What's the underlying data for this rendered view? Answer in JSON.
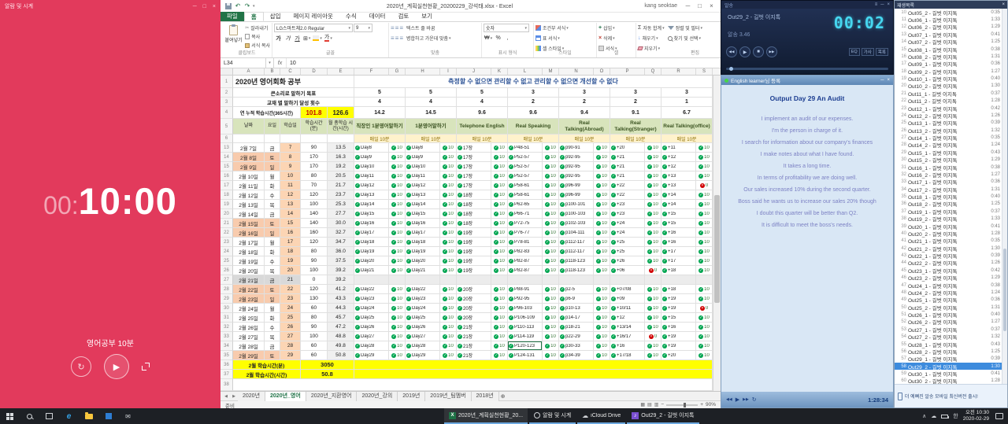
{
  "icons": {
    "check": "✓",
    "cross": "×"
  },
  "timer": {
    "window_title": "알람 및 시계",
    "time_prefix": "00:",
    "time_main": "10:00",
    "label": "영어공부 10분",
    "accent": "#e23a5c"
  },
  "excel": {
    "title": "2020년_계획실천현황_20200229_강석태.xlsx - Excel",
    "user": "kang seoktae",
    "tabs": [
      "파일",
      "홈",
      "삽입",
      "페이지 레이아웃",
      "수식",
      "데이터",
      "검토",
      "보기"
    ],
    "active_tab": "홈",
    "ribbon": {
      "paste": "붙여넣기",
      "cut": "잘라내기",
      "copy": "복사",
      "format_painter": "서식 복사",
      "clipboard_group": "클립보드",
      "font_name": "LG스마트체2.0 Regular",
      "font_size": "9",
      "font_group": "글꼴",
      "wrap_text": "텍스트 줄 바꿈",
      "merge_center": "병합하고 가운데 맞춤",
      "align_group": "맞춤",
      "number_format": "숫자",
      "number_group": "표시 형식",
      "cond_format": "조건부 서식",
      "table_format": "표 서식",
      "cell_styles": "셀 스타일",
      "style_group": "스타일",
      "insert": "삽입",
      "delete": "삭제",
      "format": "서식",
      "cells_group": "셀",
      "autosum": "자동 합계",
      "fill": "채우기",
      "clear": "지우기",
      "sort_filter": "정렬 및 필터",
      "find_select": "찾기 및 선택",
      "edit_group": "편집"
    },
    "name_box": "L34",
    "formula_value": "10",
    "columns": [
      "A",
      "B",
      "C",
      "D",
      "E",
      "F",
      "G",
      "H",
      "I",
      "J",
      "K",
      "L",
      "M",
      "N",
      "O",
      "P",
      "Q",
      "R",
      "S"
    ],
    "sheet": {
      "title": "2020년 영어회화 공부",
      "motto": "측정할 수 없으면 관리할 수 없고 관리할 수 없으면 개선할 수 없다",
      "goal_label": "큰소리로 말하기 목표",
      "goal_values": [
        "5",
        "5",
        "5",
        "3",
        "3",
        "3",
        "3"
      ],
      "achieve_label": "교재 별 말하기 달성 횟수",
      "achieve_values": [
        "4",
        "4",
        "4",
        "2",
        "2",
        "2",
        "1"
      ],
      "annual_label": "연 누적 학습시간(365시간)",
      "annual_min": "101.8",
      "annual_hours": "126.6",
      "category_totals": [
        "14.2",
        "14.5",
        "9.6",
        "9.6",
        "9.4",
        "9.1",
        "6.7"
      ],
      "col_headers": [
        "날짜",
        "요일",
        "학습일",
        "학습시간(분)",
        "월 총학습 시간(시간)"
      ],
      "categories": [
        "직장인 1분영어말하기",
        "1분영어말하기",
        "Telephone English",
        "Real Speaking",
        "Real Talking(Abroad)",
        "Real Talking(Stranger)",
        "Real Talking(office)"
      ],
      "daily_goal": "매일 10분",
      "minute_badge": "10",
      "rows": [
        {
          "n": "13",
          "a": "2월 7일",
          "b": "금",
          "c": "7",
          "d": "90",
          "e": "13.5",
          "cats": [
            "Day8",
            "Day8",
            "17장",
            "P48-51",
            "p90-91",
            "+20",
            "+11"
          ]
        },
        {
          "n": "14",
          "a": "2월 8일",
          "b": "토",
          "c": "8",
          "d": "170",
          "e": "16.3",
          "cats": [
            "Day9",
            "Day9",
            "17장",
            "P52-57",
            "p92-95",
            "+21",
            "+12"
          ],
          "wk": true
        },
        {
          "n": "15",
          "a": "2월 9일",
          "b": "일",
          "c": "9",
          "d": "170",
          "e": "19.2",
          "cats": [
            "Day10",
            "Day10",
            "17장",
            "P52-57",
            "p92-95",
            "+21",
            "+12"
          ],
          "wk": true
        },
        {
          "n": "16",
          "a": "2월 10일",
          "b": "월",
          "c": "10",
          "d": "80",
          "e": "20.5",
          "cats": [
            "Day11",
            "Day11",
            "17장",
            "P52-57",
            "p92-95",
            "+21",
            "+13"
          ]
        },
        {
          "n": "17",
          "a": "2월 11일",
          "b": "화",
          "c": "11",
          "d": "70",
          "e": "21.7",
          "cats": [
            "Day12",
            "Day12",
            "17장",
            "P58-61",
            "p96-99",
            "+22",
            "+13"
          ],
          "red": [
            6
          ]
        },
        {
          "n": "18",
          "a": "2월 12일",
          "b": "수",
          "c": "12",
          "d": "120",
          "e": "23.7",
          "cats": [
            "Day13",
            "Day13",
            "18장",
            "P58-61",
            "p96-99",
            "+22",
            "+14"
          ]
        },
        {
          "n": "19",
          "a": "2월 13일",
          "b": "목",
          "c": "13",
          "d": "100",
          "e": "25.3",
          "cats": [
            "Day14",
            "Day14",
            "18장",
            "P62-65",
            "p100-101",
            "+23",
            "+14"
          ]
        },
        {
          "n": "20",
          "a": "2월 14일",
          "b": "금",
          "c": "14",
          "d": "140",
          "e": "27.7",
          "cats": [
            "Day15",
            "Day15",
            "18장",
            "P66-71",
            "p100-103",
            "+23",
            "+15"
          ]
        },
        {
          "n": "21",
          "a": "2월 15일",
          "b": "토",
          "c": "15",
          "d": "140",
          "e": "30.0",
          "cats": [
            "Day16",
            "Day16",
            "18장",
            "P72-75",
            "p102-103",
            "+24",
            "+15"
          ],
          "wk": true
        },
        {
          "n": "22",
          "a": "2월 16일",
          "b": "일",
          "c": "16",
          "d": "160",
          "e": "32.7",
          "cats": [
            "Day17",
            "Day17",
            "19장",
            "P76-77",
            "p104-111",
            "+24",
            "+16"
          ],
          "wk": true
        },
        {
          "n": "23",
          "a": "2월 17일",
          "b": "월",
          "c": "17",
          "d": "120",
          "e": "34.7",
          "cats": [
            "Day18",
            "Day18",
            "19장",
            "P78-81",
            "p112-117",
            "+25",
            "+16"
          ]
        },
        {
          "n": "24",
          "a": "2월 18일",
          "b": "화",
          "c": "18",
          "d": "80",
          "e": "36.0",
          "cats": [
            "Day19",
            "Day19",
            "19장",
            "P82-83",
            "p112-117",
            "+25",
            "+17"
          ]
        },
        {
          "n": "25",
          "a": "2월 19일",
          "b": "수",
          "c": "19",
          "d": "90",
          "e": "37.5",
          "cats": [
            "Day20",
            "Day20",
            "19장",
            "P82-87",
            "p118-123",
            "+26",
            "+17"
          ]
        },
        {
          "n": "26",
          "a": "2월 20일",
          "b": "목",
          "c": "20",
          "d": "100",
          "e": "39.2",
          "cats": [
            "Day21",
            "Day21",
            "19장",
            "P82-87",
            "p118-123",
            "+06",
            "+18"
          ],
          "red": [
            5
          ]
        },
        {
          "n": "27",
          "a": "2월 21일",
          "b": "금",
          "c": "21",
          "d": "0",
          "e": "39.2",
          "cats": [
            "",
            "",
            "",
            "",
            "",
            "",
            ""
          ],
          "off": true
        },
        {
          "n": "28",
          "a": "2월 22일",
          "b": "토",
          "c": "22",
          "d": "120",
          "e": "41.2",
          "cats": [
            "Day22",
            "Day22",
            "20장",
            "P88-91",
            "p2-5",
            "+07/08",
            "+18"
          ],
          "wk": true
        },
        {
          "n": "29",
          "a": "2월 23일",
          "b": "일",
          "c": "23",
          "d": "130",
          "e": "43.3",
          "cats": [
            "Day23",
            "Day23",
            "20장",
            "P92-95",
            "p6-9",
            "+09",
            "+19"
          ],
          "wk": true
        },
        {
          "n": "30",
          "a": "2월 24일",
          "b": "월",
          "c": "24",
          "d": "60",
          "e": "44.3",
          "cats": [
            "Day24",
            "Day24",
            "20장",
            "P96-103",
            "p10-13",
            "+10/11",
            "+19"
          ],
          "red": [
            6
          ]
        },
        {
          "n": "31",
          "a": "2월 25일",
          "b": "화",
          "c": "25",
          "d": "80",
          "e": "45.7",
          "cats": [
            "Day25",
            "Day25",
            "20장",
            "P106-109",
            "p14-17",
            "+12",
            "+15"
          ]
        },
        {
          "n": "32",
          "a": "2월 26일",
          "b": "수",
          "c": "26",
          "d": "90",
          "e": "47.2",
          "cats": [
            "Day26",
            "Day26",
            "21장",
            "P110-113",
            "p18-21",
            "+13/14",
            "+16"
          ]
        },
        {
          "n": "33",
          "a": "2월 27일",
          "b": "목",
          "c": "27",
          "d": "100",
          "e": "48.8",
          "cats": [
            "Day27",
            "Day27",
            "21장",
            "P114-119",
            "p22-29",
            "+16/17",
            "+19"
          ],
          "red": [
            5
          ]
        },
        {
          "n": "34",
          "a": "2월 28일",
          "b": "금",
          "c": "28",
          "d": "60",
          "e": "49.8",
          "cats": [
            "Day28",
            "Day28",
            "21장",
            "P120-123",
            "p30-33",
            "+16",
            "+19"
          ]
        },
        {
          "n": "35",
          "a": "2월 29일",
          "b": "토",
          "c": "29",
          "d": "60",
          "e": "50.8",
          "cats": [
            "Day29",
            "Day29",
            "21장",
            "P124-131",
            "p34-39",
            "+17/18",
            "+20"
          ],
          "wk": true
        }
      ],
      "summary_min_label": "2월 학습시간(분)",
      "summary_min_value": "3050",
      "summary_hour_label": "2월 학습시간(시간)",
      "summary_hour_value": "50.8"
    },
    "sheets": [
      "2020년",
      "2020년_영어",
      "2020년_지환영어",
      "2020년_강의",
      "2019년",
      "2019년_팀멤버",
      "2018년"
    ],
    "active_sheet": "2020년_영어",
    "status": "준비",
    "zoom": "90%"
  },
  "player": {
    "window_title": "알송",
    "track": "Out29_2 - 길벗 이지톡",
    "info": "알송 3.46",
    "elapsed": "00:02",
    "buttons": [
      "EQ",
      "가사",
      "목록"
    ]
  },
  "lyrics": {
    "registered_by": "English learner님 등록",
    "title": "Output Day 29 An Audit",
    "lines": [
      "I implement an audit of our expenses.",
      "I'm the person in charge of it.",
      "I search for information about our company's finances",
      "I make notes about what I have found.",
      "It takes a long time.",
      "In terms of profitability we are doing well.",
      "Our sales increased 10% during the second quarter.",
      "Boss said he wants us to increase our sales 20% though",
      "I doubt this quarter will be better than Q2.",
      "It is difficult to meet the boss's needs."
    ],
    "total_time": "1:28:34"
  },
  "playlist": {
    "title": "재생목록",
    "selected": 58,
    "ad": "더 예뻐진 알송 모바일 최신버전 출시!",
    "tracks": [
      [
        10,
        "Out05_2 - 길벗 이지톡",
        "0:35"
      ],
      [
        11,
        "Out06_1 - 길벗 이지톡",
        "1:33"
      ],
      [
        12,
        "Out06_2 - 길벗 이지톡",
        "1:29"
      ],
      [
        13,
        "Out07_1 - 길벗 이지톡",
        "0:41"
      ],
      [
        14,
        "Out07_2 - 길벗 이지톡",
        "1:25"
      ],
      [
        15,
        "Out08_1 - 길벗 이지톡",
        "0:38"
      ],
      [
        16,
        "Out08_2 - 길벗 이지톡",
        "1:31"
      ],
      [
        17,
        "Out09_1 - 길벗 이지톡",
        "0:36"
      ],
      [
        18,
        "Out09_2 - 길벗 이지톡",
        "1:27"
      ],
      [
        19,
        "Out10_1 - 길벗 이지톡",
        "0:40"
      ],
      [
        20,
        "Out10_2 - 길벗 이지톡",
        "1:30"
      ],
      [
        21,
        "Out11_1 - 길벗 이지톡",
        "0:37"
      ],
      [
        22,
        "Out11_2 - 길벗 이지톡",
        "1:28"
      ],
      [
        23,
        "Out12_1 - 길벗 이지톡",
        "0:42"
      ],
      [
        24,
        "Out12_2 - 길벗 이지톡",
        "1:26"
      ],
      [
        25,
        "Out13_1 - 길벗 이지톡",
        "0:39"
      ],
      [
        26,
        "Out13_2 - 길벗 이지톡",
        "1:32"
      ],
      [
        27,
        "Out14_1 - 길벗 이지톡",
        "0:35"
      ],
      [
        28,
        "Out14_2 - 길벗 이지톡",
        "1:24"
      ],
      [
        29,
        "Out15_1 - 길벗 이지톡",
        "0:43"
      ],
      [
        30,
        "Out15_2 - 길벗 이지톡",
        "1:29"
      ],
      [
        31,
        "Out16_1 - 길벗 이지톡",
        "0:38"
      ],
      [
        32,
        "Out16_2 - 길벗 이지톡",
        "1:27"
      ],
      [
        33,
        "Out17_1 - 길벗 이지톡",
        "0:36"
      ],
      [
        34,
        "Out17_2 - 길벗 이지톡",
        "1:31"
      ],
      [
        35,
        "Out18_1 - 길벗 이지톡",
        "0:40"
      ],
      [
        36,
        "Out18_2 - 길벗 이지톡",
        "1:25"
      ],
      [
        37,
        "Out19_1 - 길벗 이지톡",
        "0:37"
      ],
      [
        38,
        "Out19_2 - 길벗 이지톡",
        "1:33"
      ],
      [
        39,
        "Out20_1 - 길벗 이지톡",
        "0:41"
      ],
      [
        40,
        "Out20_2 - 길벗 이지톡",
        "1:28"
      ],
      [
        41,
        "Out21_1 - 길벗 이지톡",
        "0:35"
      ],
      [
        42,
        "Out21_2 - 길벗 이지톡",
        "1:30"
      ],
      [
        43,
        "Out22_1 - 길벗 이지톡",
        "0:39"
      ],
      [
        44,
        "Out22_2 - 길벗 이지톡",
        "1:26"
      ],
      [
        45,
        "Out23_1 - 길벗 이지톡",
        "0:42"
      ],
      [
        46,
        "Out23_2 - 길벗 이지톡",
        "1:29"
      ],
      [
        47,
        "Out24_1 - 길벗 이지톡",
        "0:38"
      ],
      [
        48,
        "Out24_2 - 길벗 이지톡",
        "1:24"
      ],
      [
        49,
        "Out25_1 - 길벗 이지톡",
        "0:36"
      ],
      [
        50,
        "Out25_2 - 길벗 이지톡",
        "1:31"
      ],
      [
        51,
        "Out26_1 - 길벗 이지톡",
        "0:40"
      ],
      [
        52,
        "Out26_2 - 길벗 이지톡",
        "1:27"
      ],
      [
        53,
        "Out27_1 - 길벗 이지톡",
        "0:37"
      ],
      [
        54,
        "Out27_2 - 길벗 이지톡",
        "1:32"
      ],
      [
        55,
        "Out28_1 - 길벗 이지톡",
        "0:43"
      ],
      [
        56,
        "Out28_2 - 길벗 이지톡",
        "1:25"
      ],
      [
        57,
        "Out29_1 - 길벗 이지톡",
        "0:39"
      ],
      [
        58,
        "Out29_2 - 길벗 이지톡",
        "1:30"
      ],
      [
        59,
        "Out30_1 - 길벗 이지톡",
        "0:41"
      ],
      [
        60,
        "Out30_2 - 길벗 이지톡",
        "1:28"
      ]
    ]
  },
  "taskbar": {
    "buttons": [
      {
        "label": "2020년_계획실천현황_20...",
        "icon": "excel",
        "active": true
      },
      {
        "label": "알람 및 시계",
        "icon": "clock"
      },
      {
        "label": "iCloud Drive",
        "icon": "cloud"
      },
      {
        "label": "Out29_2 - 길벗 이지톡",
        "icon": "music"
      }
    ],
    "ime": "한",
    "time": "오전 10:30",
    "date": "2020-02-29"
  }
}
